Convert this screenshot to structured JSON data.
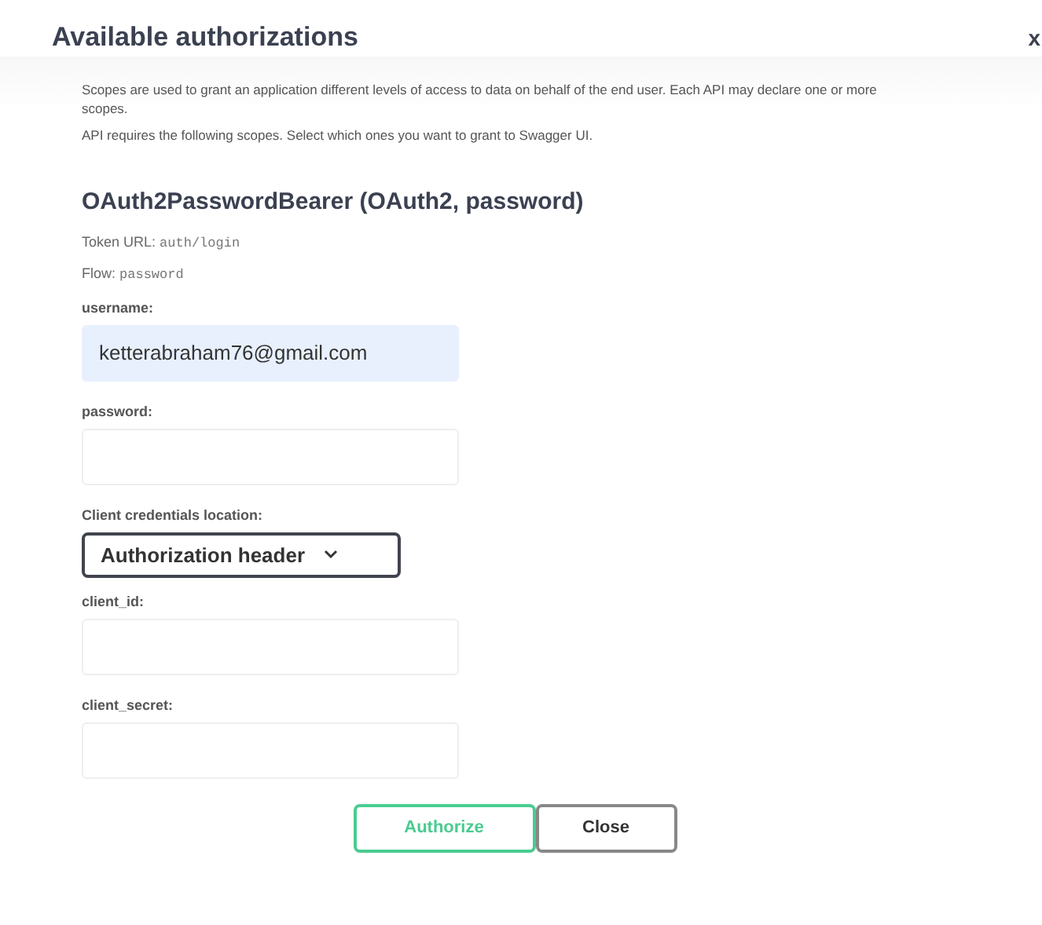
{
  "dialog": {
    "title": "Available authorizations",
    "close": "x",
    "description": [
      "Scopes are used to grant an application different levels of access to data on behalf of the end user. Each API may declare one or more scopes.",
      "API requires the following scopes. Select which ones you want to grant to Swagger UI."
    ],
    "scheme": {
      "title": "OAuth2PasswordBearer (OAuth2, password)",
      "token_url_label": "Token URL:",
      "token_url": "auth/login",
      "flow_label": "Flow:",
      "flow": "password",
      "fields": [
        {
          "kind": "input",
          "label": "username:",
          "value": "ketterabraham76@gmail.com"
        },
        {
          "kind": "input",
          "label": "password:"
        },
        {
          "kind": "select",
          "label": "Client credentials location:",
          "value": "Authorization header"
        },
        {
          "kind": "input",
          "label": "client_id:"
        },
        {
          "kind": "input",
          "label": "client_secret:"
        }
      ]
    },
    "buttons": [
      {
        "label": "Authorize",
        "kind": "primary"
      },
      {
        "label": "Close",
        "kind": "secondary"
      }
    ]
  }
}
